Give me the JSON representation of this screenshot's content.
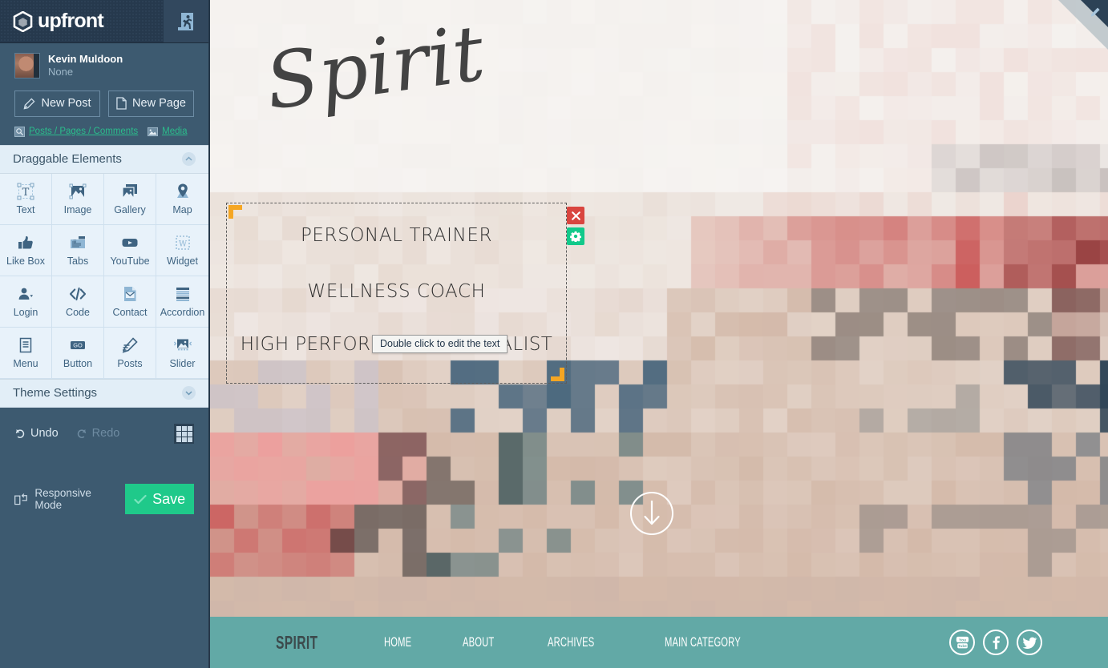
{
  "sidebar": {
    "brand": {
      "name": "upfront",
      "logo_icon": "hexagon-cube-icon",
      "exit_icon": "exit-running-man-icon"
    },
    "user": {
      "name": "Kevin Muldoon",
      "role": "None",
      "avatar_icon": "user-avatar"
    },
    "actions": [
      {
        "label": "New Post",
        "icon": "pencil-icon"
      },
      {
        "label": "New Page",
        "icon": "page-icon"
      }
    ],
    "links": [
      {
        "label": "Posts / Pages / Comments",
        "icon": "posts-icon"
      },
      {
        "label": "Media",
        "icon": "media-icon"
      }
    ],
    "panels": {
      "draggable": {
        "title": "Draggable Elements",
        "toggle_icon": "chevron-up-icon"
      },
      "theme": {
        "title": "Theme Settings",
        "toggle_icon": "chevron-down-icon"
      }
    },
    "elements": [
      {
        "label": "Text",
        "icon": "text-t-icon"
      },
      {
        "label": "Image",
        "icon": "image-icon"
      },
      {
        "label": "Gallery",
        "icon": "gallery-icon"
      },
      {
        "label": "Map",
        "icon": "map-pin-icon"
      },
      {
        "label": "Like Box",
        "icon": "thumbs-up-icon"
      },
      {
        "label": "Tabs",
        "icon": "tabs-icon"
      },
      {
        "label": "YouTube",
        "icon": "youtube-play-icon"
      },
      {
        "label": "Widget",
        "icon": "widget-w-icon"
      },
      {
        "label": "Login",
        "icon": "user-login-icon"
      },
      {
        "label": "Code",
        "icon": "code-brackets-icon"
      },
      {
        "label": "Contact",
        "icon": "envelope-contact-icon"
      },
      {
        "label": "Accordion",
        "icon": "accordion-icon"
      },
      {
        "label": "Menu",
        "icon": "menu-list-icon"
      },
      {
        "label": "Button",
        "icon": "go-button-icon"
      },
      {
        "label": "Posts",
        "icon": "posts-pencil-icon"
      },
      {
        "label": "Slider",
        "icon": "slider-icon"
      }
    ],
    "tools": {
      "undo": {
        "label": "Undo",
        "icon": "undo-arrow-icon",
        "enabled": true
      },
      "redo": {
        "label": "Redo",
        "icon": "redo-arrow-icon",
        "enabled": false
      },
      "grid": {
        "icon": "grid-icon"
      },
      "responsive": {
        "label": "Responsive Mode",
        "icon": "responsive-devices-icon"
      },
      "save": {
        "label": "Save",
        "icon": "check-icon"
      }
    }
  },
  "canvas": {
    "corner_edit_icon": "pencil-edit-corner-icon",
    "site_logo_text": "Spirit",
    "scroll_down_icon": "arrow-down-circle-icon",
    "selected_element": {
      "lines": [
        "PERSONAL TRAINER",
        "WELLNESS COACH",
        "HIGH PERFORMANCE SPECIALIST"
      ],
      "controls": [
        {
          "name": "delete",
          "icon": "close-x-icon"
        },
        {
          "name": "settings",
          "icon": "gear-icon"
        }
      ],
      "handle_color": "#f5a623"
    },
    "tooltip": {
      "text": "Double click to edit the text"
    },
    "footer": {
      "brand": "SPIRIT",
      "nav": [
        "HOME",
        "ABOUT",
        "ARCHIVES",
        "MAIN CATEGORY"
      ],
      "social": [
        {
          "name": "youtube",
          "icon": "youtube-icon"
        },
        {
          "name": "facebook",
          "icon": "facebook-icon"
        },
        {
          "name": "twitter",
          "icon": "twitter-icon"
        }
      ],
      "background_color": "#62a9a6"
    }
  },
  "colors": {
    "sidebar_bg": "#3d5a70",
    "brandbar_bg": "#26394d",
    "panel_bg": "#e8f2fa",
    "panel_head_bg": "#e2eef7",
    "accent_green": "#1fc98a",
    "link_green": "#2bbd8c",
    "delete_red": "#d9453f",
    "handle_orange": "#f5a623",
    "footer_teal": "#62a9a6"
  }
}
